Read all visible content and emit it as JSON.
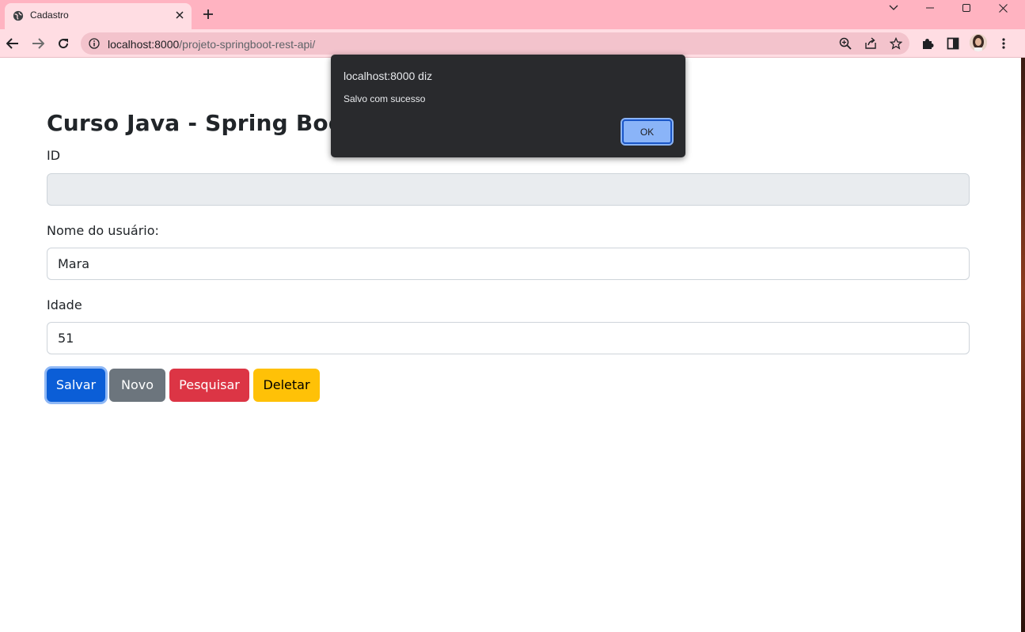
{
  "browser": {
    "tab_title": "Cadastro",
    "url_host": "localhost:8000",
    "url_path": "/projeto-springboot-rest-api/"
  },
  "page": {
    "heading": "Curso Java - Spring Boot R",
    "fields": {
      "id_label": "ID",
      "id_value": "",
      "name_label": "Nome do usuário:",
      "name_value": "Mara",
      "age_label": "Idade",
      "age_value": "51"
    },
    "buttons": {
      "save": "Salvar",
      "new": "Novo",
      "search": "Pesquisar",
      "delete": "Deletar"
    }
  },
  "dialog": {
    "title": "localhost:8000 diz",
    "message": "Salvo com sucesso",
    "ok_label": "OK"
  },
  "colors": {
    "primary": "#0b5ed7",
    "secondary": "#6c757d",
    "danger": "#dc3545",
    "warning": "#ffc107",
    "tabbar": "#ffb3c1"
  }
}
